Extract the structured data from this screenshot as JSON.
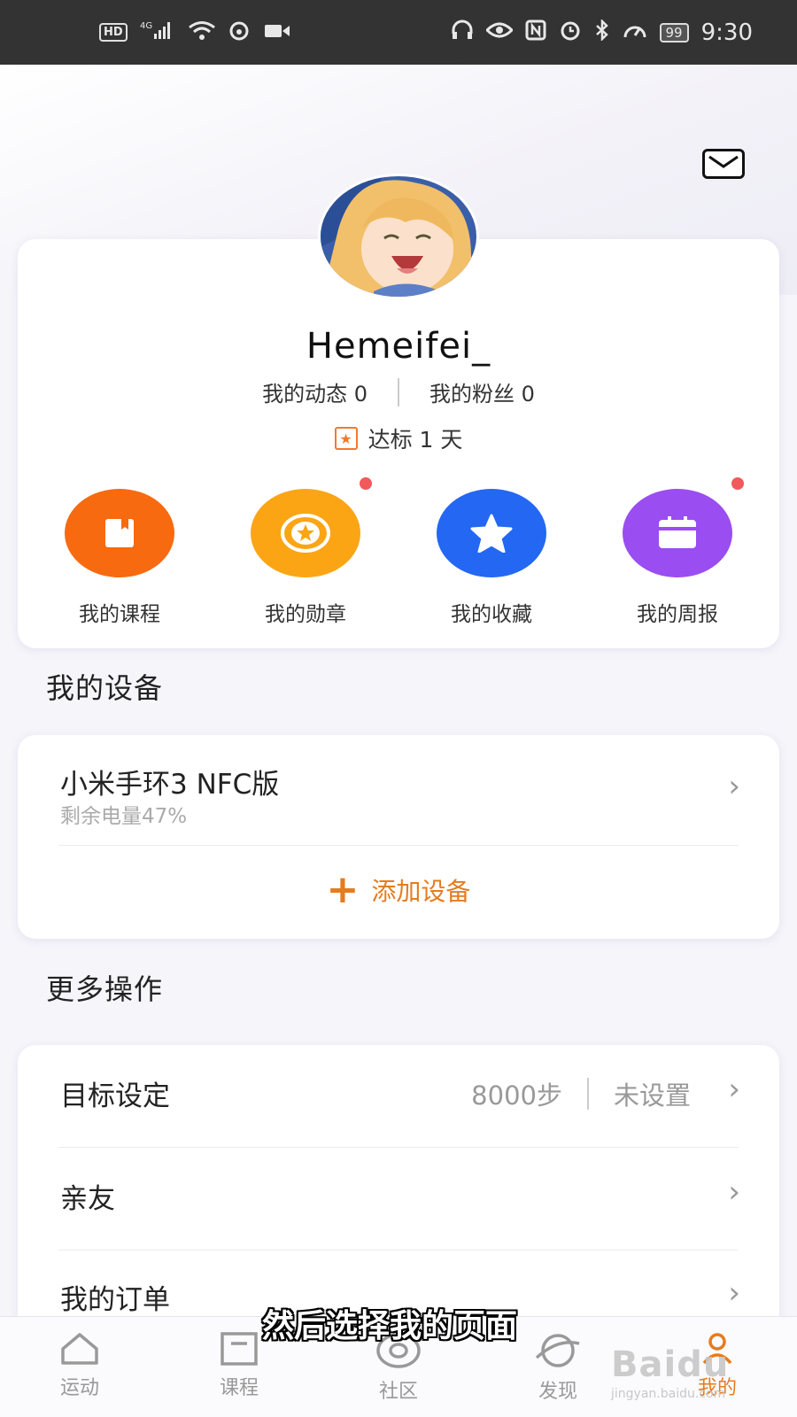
{
  "status_bar": {
    "left_icons": [
      "hd-icon",
      "4g-signal-icon",
      "wifi-icon",
      "weibo-icon",
      "video-icon"
    ],
    "hd_label": "HD",
    "network_label": "4G",
    "right_icons": [
      "headset-icon",
      "eye-icon",
      "nfc-icon",
      "alarm-icon",
      "bluetooth-icon",
      "speed-icon"
    ],
    "battery": "99",
    "time": "9:30"
  },
  "profile": {
    "username": "Hemeifei_",
    "moments_label": "我的动态 0",
    "fans_label": "我的粉丝 0",
    "goal_label": "达标 1 天"
  },
  "quick_actions": [
    {
      "label": "我的课程",
      "color": "#f76a0f",
      "icon": "course-icon",
      "dot": false
    },
    {
      "label": "我的勋章",
      "color": "#fba515",
      "icon": "medal-icon",
      "dot": true
    },
    {
      "label": "我的收藏",
      "color": "#2367f3",
      "icon": "star-icon",
      "dot": false
    },
    {
      "label": "我的周报",
      "color": "#9a4df0",
      "icon": "report-icon",
      "dot": true
    }
  ],
  "devices": {
    "title": "我的设备",
    "device_name": "小米手环3 NFC版",
    "device_battery": "剩余电量47%",
    "add_label": "添加设备"
  },
  "more": {
    "title": "更多操作",
    "rows": [
      {
        "label": "目标设定",
        "value": "8000步",
        "status": "未设置"
      },
      {
        "label": "亲友"
      },
      {
        "label": "我的订单"
      }
    ]
  },
  "subtitle_overlay": "然后选择我的页面",
  "tabbar": {
    "tabs": [
      {
        "label": "运动",
        "icon": "home-icon"
      },
      {
        "label": "课程",
        "icon": "course-tab-icon"
      },
      {
        "label": "社区",
        "icon": "community-icon"
      },
      {
        "label": "发现",
        "icon": "discover-icon"
      },
      {
        "label": "我的",
        "icon": "profile-icon"
      }
    ],
    "active_index": 4,
    "active_color": "#e57c1f"
  },
  "watermark": {
    "brand": "Baidu",
    "sub": "jingyan.baidu.com"
  }
}
